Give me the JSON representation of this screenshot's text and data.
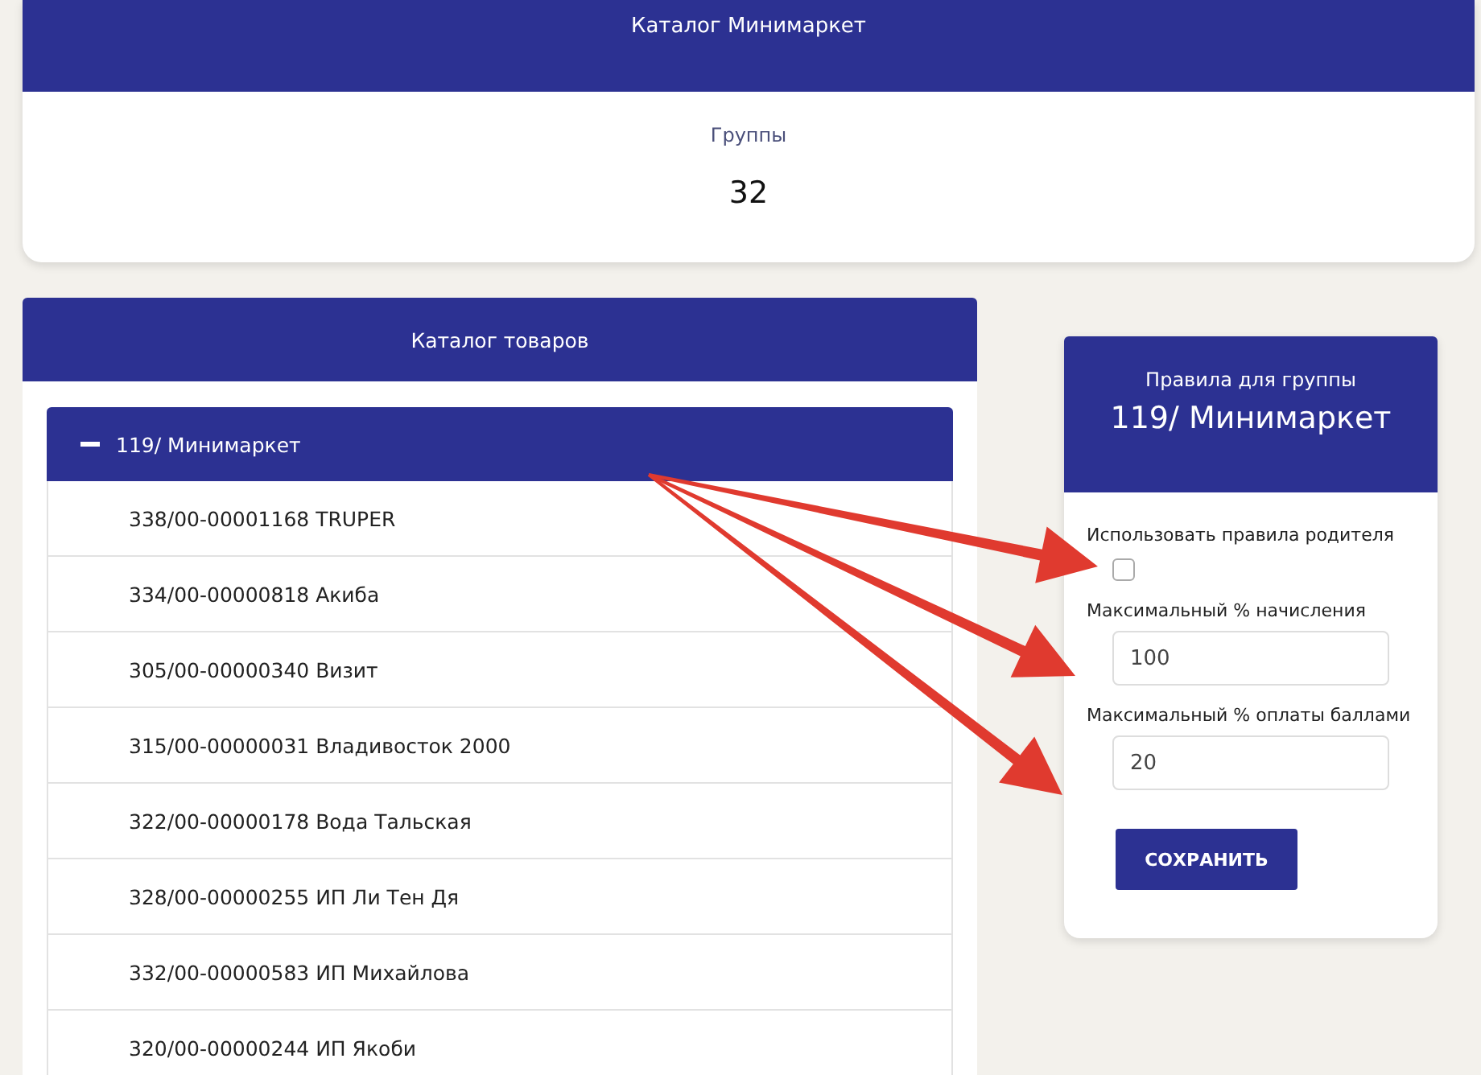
{
  "header": {
    "title": "Каталог Минимаркет"
  },
  "summary": {
    "label": "Группы",
    "value": "32"
  },
  "catalog": {
    "title": "Каталог товаров",
    "tree": [
      {
        "label": "119/ Минимаркет",
        "expanded": true,
        "children": [
          {
            "label": "338/00-00001168 TRUPER"
          },
          {
            "label": "334/00-00000818 Акиба"
          },
          {
            "label": "305/00-00000340 Визит"
          },
          {
            "label": "315/00-00000031 Владивосток 2000"
          },
          {
            "label": "322/00-00000178 Вода Тальская"
          },
          {
            "label": "328/00-00000255 ИП Ли Тен Дя"
          },
          {
            "label": "332/00-00000583 ИП Михайлова"
          },
          {
            "label": "320/00-00000244 ИП Якоби"
          }
        ]
      }
    ]
  },
  "rules": {
    "subtitle": "Правила для группы",
    "title": "119/ Минимаркет",
    "fields": [
      {
        "kind": "checkbox",
        "label": "Использовать правила родителя",
        "checked": false
      },
      {
        "kind": "text",
        "label": "Максимальный % начисления",
        "value": "100"
      },
      {
        "kind": "text",
        "label": "Максимальный % оплаты баллами",
        "value": "20"
      }
    ],
    "button": "СОХРАНИТЬ"
  }
}
